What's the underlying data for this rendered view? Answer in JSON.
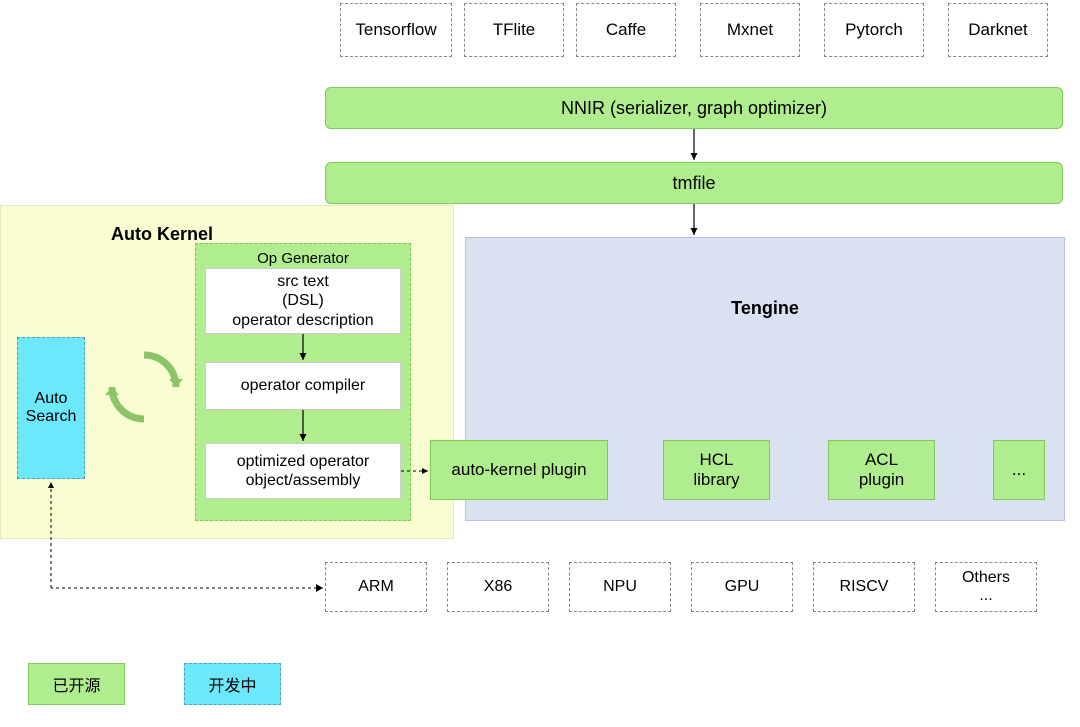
{
  "frameworks": [
    "Tensorflow",
    "TFlite",
    "Caffe",
    "Mxnet",
    "Pytorch",
    "Darknet"
  ],
  "nnir_label": "NNIR (serializer, graph optimizer)",
  "tmfile_label": "tmfile",
  "auto_kernel": {
    "title": "Auto Kernel",
    "auto_search": "Auto Search",
    "op_generator_title": "Op Generator",
    "src_text": "src text\n(DSL)\noperator description",
    "compiler": "operator compiler",
    "optimized": "optimized operator\nobject/assembly"
  },
  "tengine": {
    "title": "Tengine",
    "plugins": [
      "auto-kernel plugin",
      "HCL library",
      "ACL plugin",
      "..."
    ]
  },
  "targets": [
    "ARM",
    "X86",
    "NPU",
    "GPU",
    "RISCV",
    "Others ..."
  ],
  "legend": {
    "open_source": "已开源",
    "developing": "开发中"
  }
}
